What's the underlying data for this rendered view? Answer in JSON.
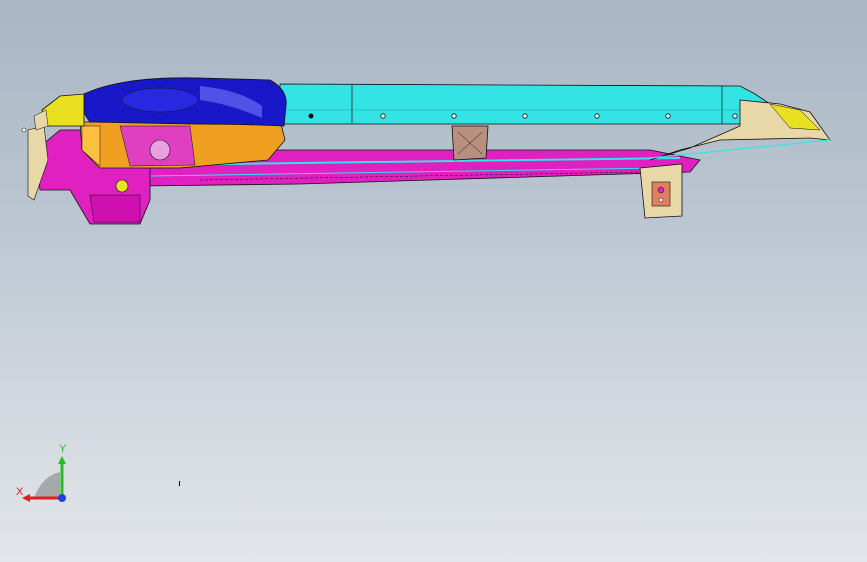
{
  "viewport": {
    "background_top": "#aab6c4",
    "background_bottom": "#e2e6ea"
  },
  "model": {
    "colors": {
      "cyan_rail": "#34e3e3",
      "blue_tank": "#1818c8",
      "orange_housing": "#f0a020",
      "magenta_frame": "#e020c0",
      "yellow_bracket": "#e8e020",
      "beige_bracket": "#e8d8a8",
      "outline": "#101010"
    }
  },
  "triad": {
    "x_label": "X",
    "y_label": "Y",
    "x_color": "#e02020",
    "y_color": "#20c020",
    "z_color": "#2040e0"
  }
}
